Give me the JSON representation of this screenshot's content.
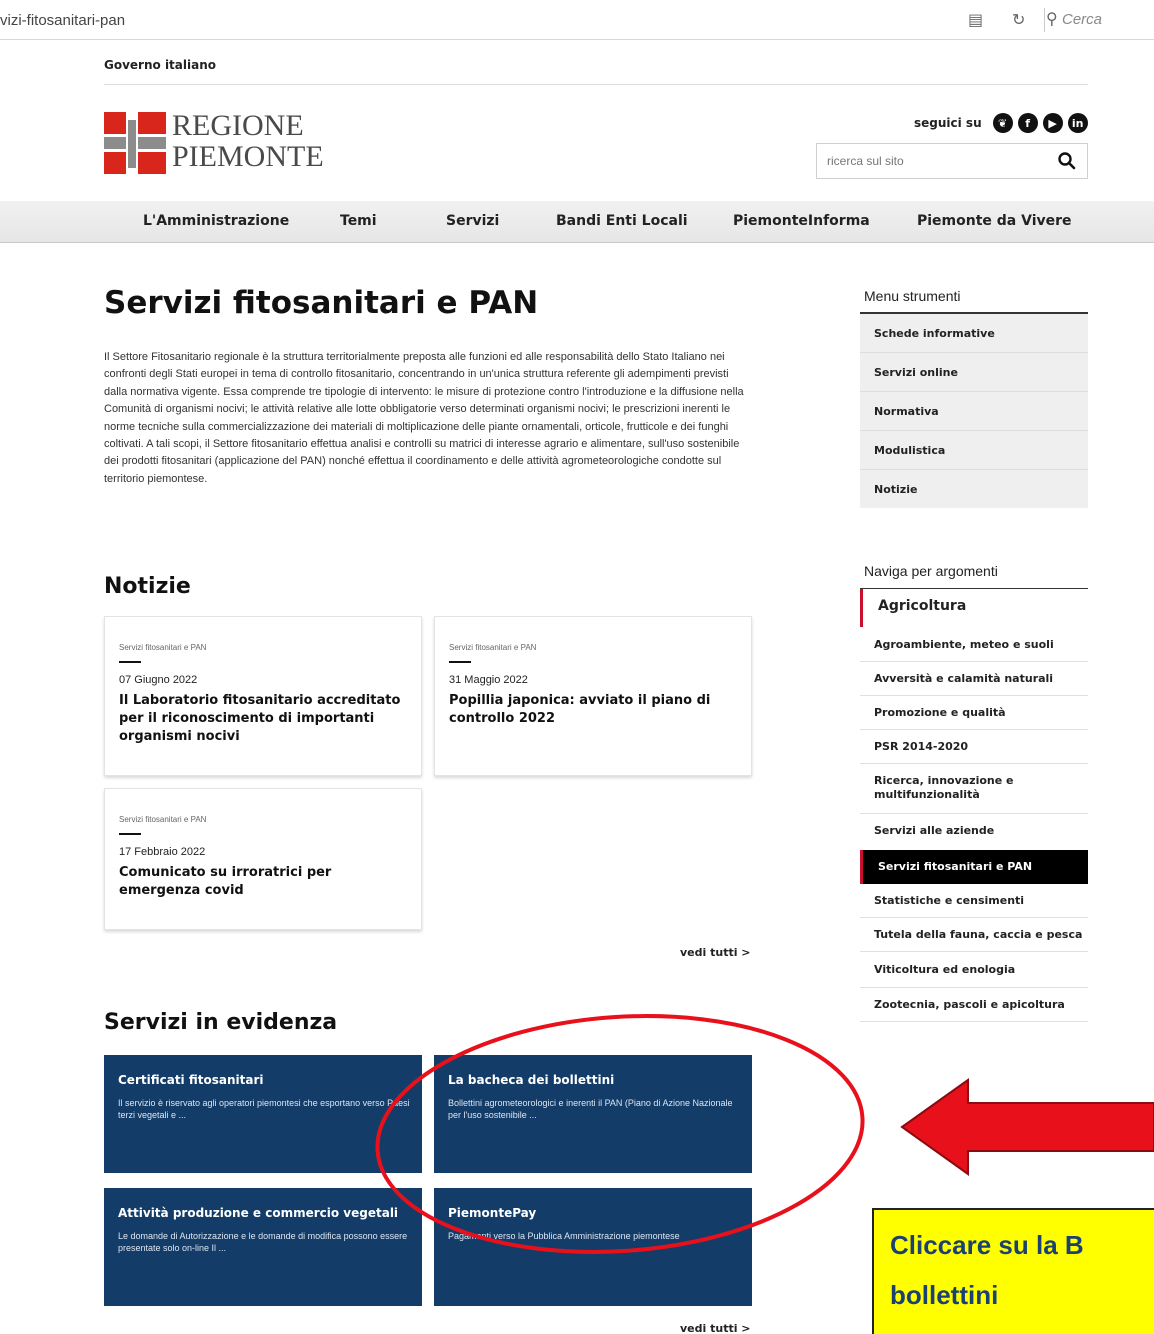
{
  "browser": {
    "url": "vizi-fitosanitari-pan",
    "search_placeholder": "Cerca"
  },
  "header": {
    "gov_label": "Governo italiano",
    "logo_line1": "REGIONE",
    "logo_line2": "PIEMONTE",
    "follow_label": "seguici su",
    "social": [
      "twitter-icon",
      "facebook-icon",
      "youtube-icon",
      "linkedin-icon"
    ],
    "search_placeholder": "ricerca sul sito"
  },
  "nav": {
    "items": [
      "L'Amministrazione",
      "Temi",
      "Servizi",
      "Bandi Enti Locali",
      "PiemonteInforma",
      "Piemonte da Vivere"
    ]
  },
  "main": {
    "title": "Servizi fitosanitari e PAN",
    "intro": "Il Settore Fitosanitario regionale è la struttura territorialmente preposta alle funzioni ed alle responsabilità dello Stato Italiano nei confronti degli Stati europei in tema di controllo fitosanitario, concentrando in un'unica struttura referente gli adempimenti previsti dalla normativa vigente. Essa comprende tre tipologie di intervento: le misure di protezione contro l'introduzione e la diffusione nella Comunità di organismi nocivi; le attività relative alle lotte obbligatorie verso determinati organismi nocivi; le prescrizioni inerenti le norme tecniche sulla commercializzazione dei materiali di moltiplicazione delle piante ornamentali, orticole, frutticole e dei funghi coltivati. A tali scopi, il Settore fitosanitario effettua analisi e controlli su matrici di interesse agrario e alimentare, sull'uso sostenibile dei prodotti fitosanitari (applicazione del PAN) nonché effettua il coordinamento e delle attività agrometeorologiche condotte sul territorio piemontese.",
    "news_title": "Notizie",
    "news": [
      {
        "category": "Servizi fitosanitari e PAN",
        "date": "07 Giugno 2022",
        "title": "Il Laboratorio fitosanitario accreditato per il riconoscimento di importanti organismi nocivi"
      },
      {
        "category": "Servizi fitosanitari e PAN",
        "date": "31 Maggio 2022",
        "title": "Popillia japonica: avviato il piano di controllo 2022"
      },
      {
        "category": "Servizi fitosanitari e PAN",
        "date": "17 Febbraio 2022",
        "title": "Comunicato su irroratrici per emergenza covid"
      }
    ],
    "see_all": "vedi tutti >",
    "services_title": "Servizi in evidenza",
    "services": [
      {
        "title": "Certificati fitosanitari",
        "desc": "Il servizio è riservato agli operatori piemontesi che esportano verso Paesi terzi vegetali e ..."
      },
      {
        "title": "La bacheca dei bollettini",
        "desc": "Bollettini agrometeorologici e inerenti il PAN (Piano di Azione Nazionale per l'uso sostenibile ..."
      },
      {
        "title": "Attività produzione e commercio vegetali",
        "desc": "Le domande di Autorizzazione e le domande di modifica possono essere presentate solo on-line Il ..."
      },
      {
        "title": "PiemontePay",
        "desc": "Pagamenti verso la Pubblica Amministrazione piemontese"
      }
    ]
  },
  "sidebar": {
    "tools_heading": "Menu strumenti",
    "tools": [
      "Schede informative",
      "Servizi online",
      "Normativa",
      "Modulistica",
      "Notizie"
    ],
    "topics_heading": "Naviga per argomenti",
    "topic_main": "Agricoltura",
    "topics": [
      "Agroambiente, meteo e suoli",
      "Avversità e calamità naturali",
      "Promozione e qualità",
      "PSR 2014-2020",
      "Ricerca, innovazione e multifunzionalità",
      "Servizi alle aziende",
      "Servizi fitosanitari e PAN",
      "Statistiche e censimenti",
      "Tutela della fauna, caccia e pesca",
      "Viticoltura ed enologia",
      "Zootecnia, pascoli e apicoltura"
    ]
  },
  "annotation": {
    "callout_line1": "Cliccare su la B",
    "callout_line2": "bollettini",
    "ellipse_color": "#e8111b",
    "arrow_color": "#e8111b",
    "callout_bg": "#ffff00"
  }
}
